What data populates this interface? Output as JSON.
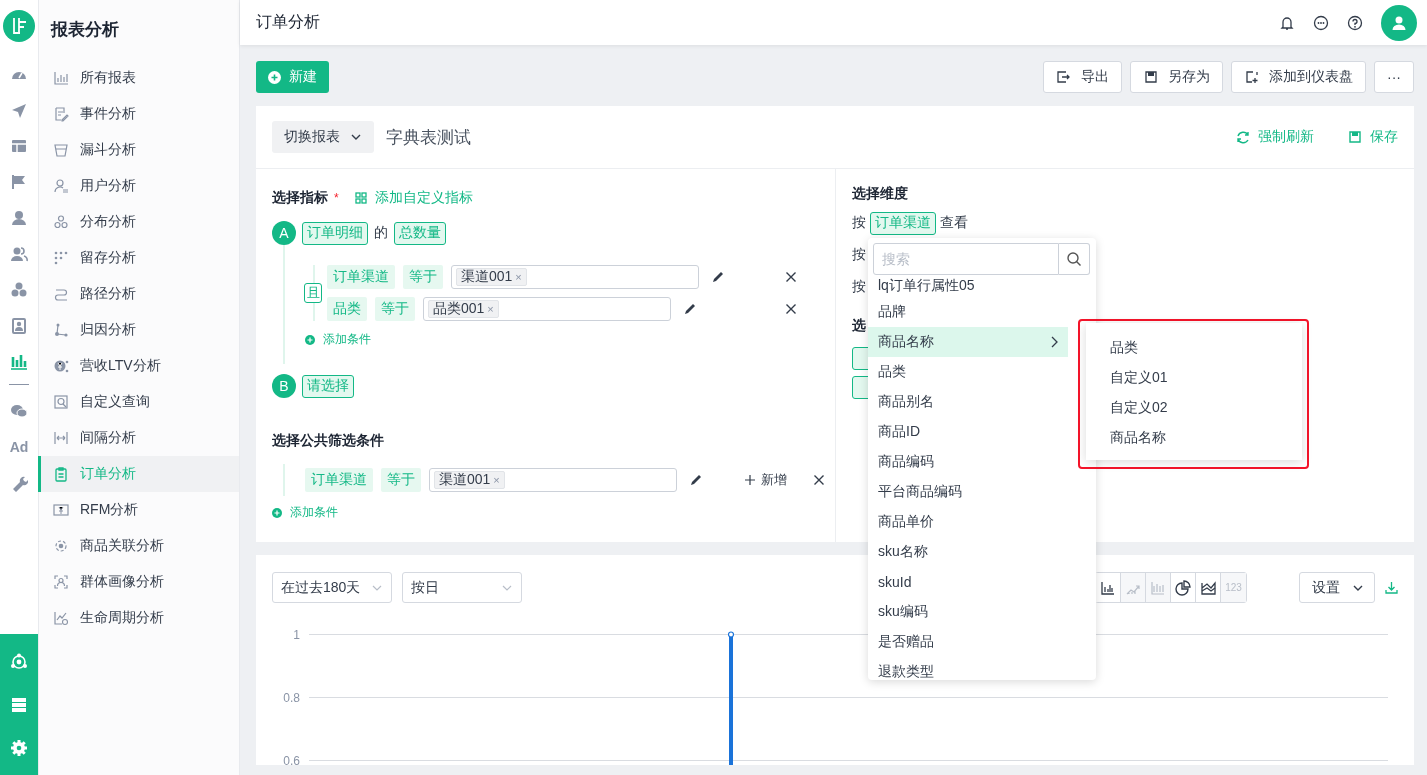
{
  "rail": {
    "items": [
      {
        "kind": "icon",
        "selected": false
      },
      {
        "kind": "icon",
        "selected": false
      },
      {
        "kind": "icon",
        "selected": false
      },
      {
        "kind": "icon",
        "selected": false
      },
      {
        "kind": "icon",
        "selected": false
      },
      {
        "kind": "icon",
        "selected": false
      },
      {
        "kind": "icon",
        "selected": false
      },
      {
        "kind": "icon",
        "selected": false
      },
      {
        "kind": "icon",
        "selected": true
      },
      {
        "kind": "divider"
      },
      {
        "kind": "icon",
        "selected": false
      },
      {
        "kind": "text",
        "label": "Ad",
        "selected": false
      },
      {
        "kind": "icon",
        "selected": false
      }
    ]
  },
  "sidebar": {
    "title": "报表分析",
    "items": [
      {
        "label": "所有报表",
        "selected": false
      },
      {
        "label": "事件分析",
        "selected": false
      },
      {
        "label": "漏斗分析",
        "selected": false
      },
      {
        "label": "用户分析",
        "selected": false
      },
      {
        "label": "分布分析",
        "selected": false
      },
      {
        "label": "留存分析",
        "selected": false
      },
      {
        "label": "路径分析",
        "selected": false
      },
      {
        "label": "归因分析",
        "selected": false
      },
      {
        "label": "营收LTV分析",
        "selected": false
      },
      {
        "label": "自定义查询",
        "selected": false
      },
      {
        "label": "间隔分析",
        "selected": false
      },
      {
        "label": "订单分析",
        "selected": true
      },
      {
        "label": "RFM分析",
        "selected": false
      },
      {
        "label": "商品关联分析",
        "selected": false
      },
      {
        "label": "群体画像分析",
        "selected": false
      },
      {
        "label": "生命周期分析",
        "selected": false
      }
    ]
  },
  "header": {
    "title": "订单分析"
  },
  "toolbar": {
    "new_button": "新建",
    "actions": [
      "导出",
      "另存为",
      "添加到仪表盘"
    ],
    "more": "···"
  },
  "report": {
    "switch_label": "切换报表",
    "name": "字典表测试",
    "refresh": "强制刷新",
    "save": "保存"
  },
  "metrics": {
    "title": "选择指标",
    "required_mark": "*",
    "add_custom": "添加自定义指标",
    "items": [
      {
        "letter": "A",
        "source": "订单明细",
        "connector": "的",
        "measure": "总数量",
        "logic": "且",
        "filters": [
          {
            "field": "订单渠道",
            "op": "等于",
            "values": [
              {
                "label": "渠道001",
                "remove": "×"
              }
            ]
          },
          {
            "field": "品类",
            "op": "等于",
            "values": [
              {
                "label": "品类001",
                "remove": "×"
              }
            ]
          }
        ],
        "add_condition": "添加条件"
      },
      {
        "letter": "B",
        "source": "请选择"
      }
    ]
  },
  "public_filters": {
    "title": "选择公共筛选条件",
    "filters": [
      {
        "field": "订单渠道",
        "op": "等于",
        "values": [
          {
            "label": "渠道001",
            "remove": "×"
          }
        ],
        "add": "新增"
      }
    ],
    "add_condition": "添加条件"
  },
  "dimensions": {
    "title": "选择维度",
    "rows": [
      {
        "prefix": "按",
        "tag": "订单渠道",
        "suffix": "查看"
      },
      {
        "prefix": "按"
      },
      {
        "prefix": "按"
      }
    ],
    "section_title": "选",
    "section_tags": [
      {
        "kind": "tag"
      },
      {
        "kind": "tag"
      }
    ]
  },
  "dimension_menu": {
    "placeholder": "搜索",
    "items": [
      {
        "label": "lq订单行属性05",
        "selected": false,
        "has_children": false
      },
      {
        "label": "品牌",
        "selected": false,
        "has_children": false
      },
      {
        "label": "商品名称",
        "selected": true,
        "has_children": true
      },
      {
        "label": "品类",
        "selected": false,
        "has_children": false
      },
      {
        "label": "商品别名",
        "selected": false,
        "has_children": false
      },
      {
        "label": "商品ID",
        "selected": false,
        "has_children": false
      },
      {
        "label": "商品编码",
        "selected": false,
        "has_children": false
      },
      {
        "label": "平台商品编码",
        "selected": false,
        "has_children": false
      },
      {
        "label": "商品单价",
        "selected": false,
        "has_children": false
      },
      {
        "label": "sku名称",
        "selected": false,
        "has_children": false
      },
      {
        "label": "skuId",
        "selected": false,
        "has_children": false
      },
      {
        "label": "sku编码",
        "selected": false,
        "has_children": false
      },
      {
        "label": "是否赠品",
        "selected": false,
        "has_children": false
      },
      {
        "label": "退款类型",
        "selected": false,
        "has_children": false
      }
    ],
    "submenu": [
      "品类",
      "自定义01",
      "自定义02",
      "商品名称"
    ]
  },
  "chart_panel": {
    "range": "在过去180天",
    "granularity": "按日",
    "types": [
      {
        "kind": "icon",
        "disabled": false
      },
      {
        "kind": "icon",
        "disabled": true
      },
      {
        "kind": "icon",
        "disabled": true
      },
      {
        "kind": "icon",
        "disabled": false
      },
      {
        "kind": "icon",
        "disabled": false
      },
      {
        "kind": "text",
        "label": "123",
        "disabled": true
      }
    ],
    "settings": "设置",
    "y_ticks": [
      "1",
      "0.8",
      "0.6"
    ]
  }
}
